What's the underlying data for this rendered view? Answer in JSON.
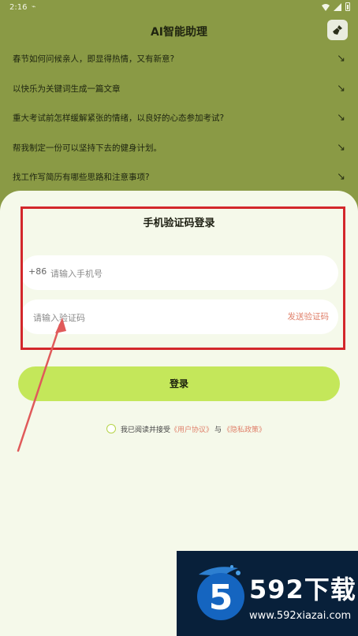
{
  "status_bar": {
    "time": "2:16"
  },
  "header": {
    "title": "AI智能助理",
    "clean_icon": "broom-icon"
  },
  "suggestions": [
    {
      "text": "春节如何问候亲人，即显得热情，又有新意?"
    },
    {
      "text": "以快乐为关键词生成一篇文章"
    },
    {
      "text": "重大考试前怎样缓解紧张的情绪，以良好的心态参加考试?"
    },
    {
      "text": "帮我制定一份可以坚持下去的健身计划。"
    },
    {
      "text": "找工作写简历有哪些思路和注意事项?"
    }
  ],
  "arrow_glyph": "↘",
  "login": {
    "title": "手机验证码登录",
    "phone_prefix": "+86",
    "phone_placeholder": "请输入手机号",
    "code_placeholder": "请输入验证码",
    "send_code": "发送验证码",
    "submit": "登录"
  },
  "agreement": {
    "prefix": "我已阅读并接受",
    "user_agreement": "《用户协议》",
    "and": "与",
    "privacy_policy": "《隐私政策》"
  },
  "watermark": {
    "brand": "592下载",
    "url": "www.592xiazai.com"
  },
  "colors": {
    "header_bg": "#8a9a45",
    "sheet_bg": "#f5f9ea",
    "accent": "#c4e75a",
    "link": "#e0816b",
    "highlight": "#d3272b"
  }
}
